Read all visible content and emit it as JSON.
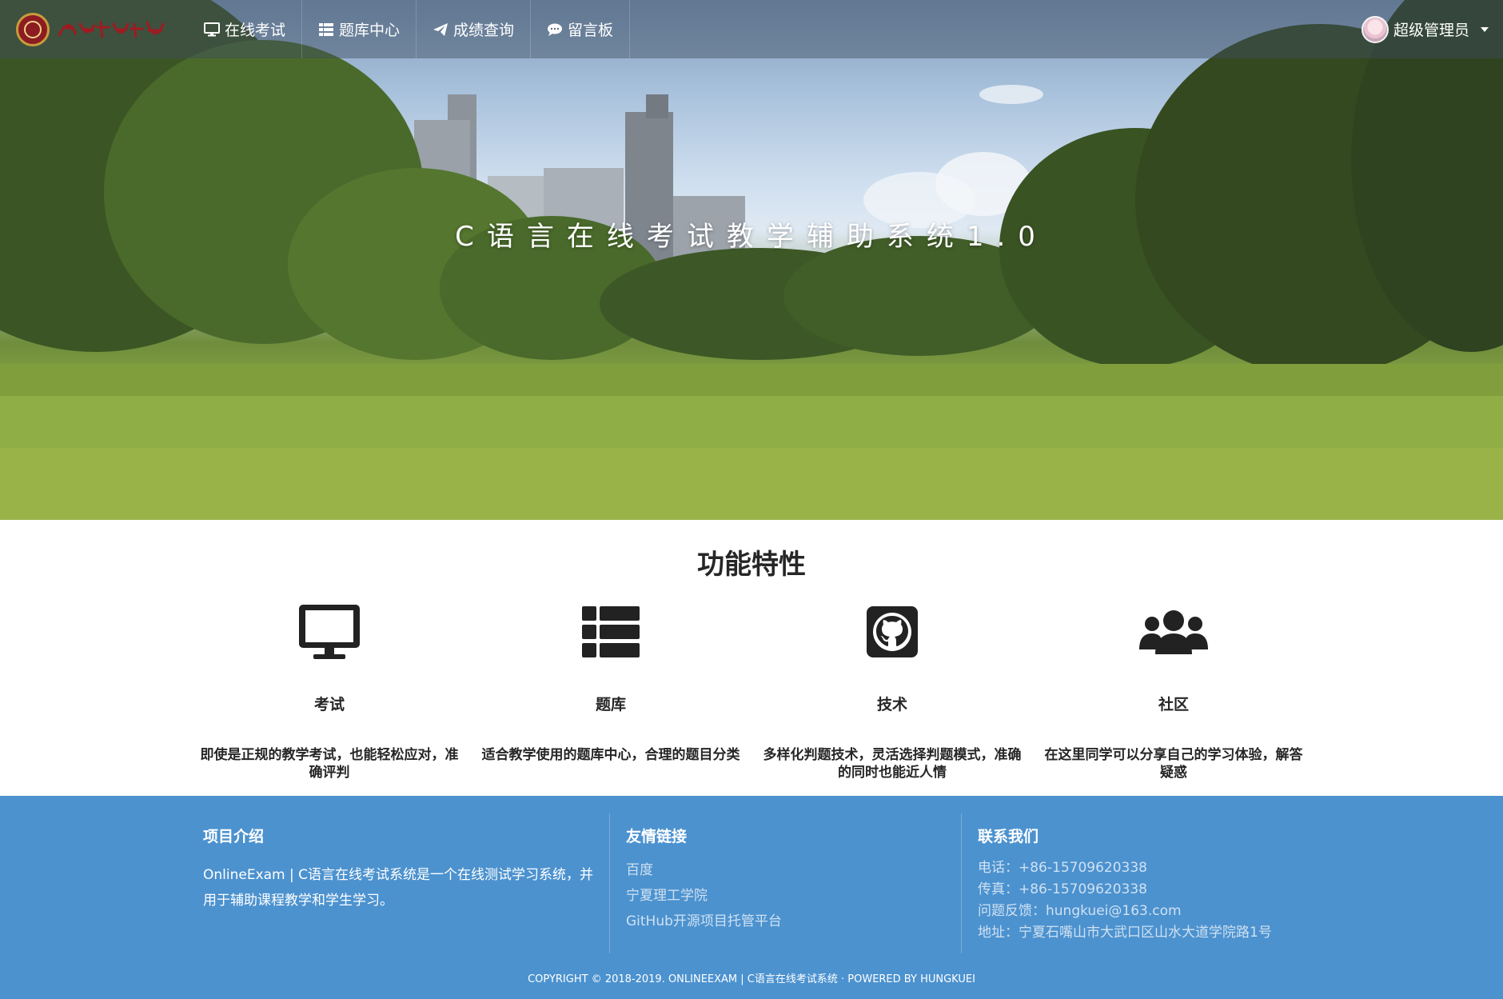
{
  "navbar": {
    "brand_text": "宁夏理工学院",
    "items": [
      {
        "label": "在线考试",
        "icon": "monitor-icon"
      },
      {
        "label": "题库中心",
        "icon": "list-icon"
      },
      {
        "label": "成绩查询",
        "icon": "paper-plane-icon"
      },
      {
        "label": "留言板",
        "icon": "comment-icon"
      }
    ],
    "user": {
      "name": "超级管理员"
    }
  },
  "hero": {
    "title": "C语言在线考试教学辅助系统1.0"
  },
  "features": {
    "heading": "功能特性",
    "items": [
      {
        "icon": "desktop-icon",
        "title": "考试",
        "desc": "即使是正规的教学考试，也能轻松应对，准确评判"
      },
      {
        "icon": "th-list-icon",
        "title": "题库",
        "desc": "适合教学使用的题库中心，合理的题目分类"
      },
      {
        "icon": "github-icon",
        "title": "技术",
        "desc": "多样化判题技术，灵活选择判题模式，准确的同时也能近人情"
      },
      {
        "icon": "users-icon",
        "title": "社区",
        "desc": "在这里同学可以分享自己的学习体验，解答疑惑"
      }
    ]
  },
  "footer": {
    "about": {
      "heading": "项目介绍",
      "text": "OnlineExam | C语言在线考试系统是一个在线测试学习系统，并用于辅助课程教学和学生学习。"
    },
    "links": {
      "heading": "友情链接",
      "items": [
        "百度",
        "宁夏理工学院",
        "GitHub开源项目托管平台"
      ]
    },
    "contact": {
      "heading": "联系我们",
      "items": [
        "电话：+86-15709620338",
        "传真：+86-15709620338",
        "问题反馈：hungkuei@163.com",
        "地址：宁夏石嘴山市大武口区山水大道学院路1号"
      ]
    },
    "copyright": "COPYRIGHT © 2018-2019. ONLINEEXAM | C语言在线考试系统 · POWERED BY HUNGKUEI"
  },
  "colors": {
    "footer_bg": "#4c92cf",
    "navbar_bg": "rgba(62,78,96,0.45)"
  }
}
